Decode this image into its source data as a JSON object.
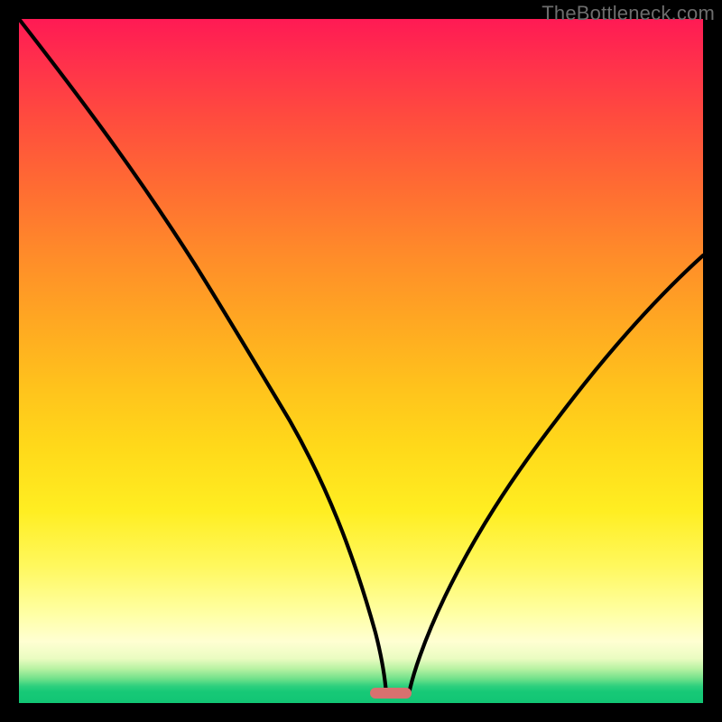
{
  "watermark": "TheBottleneck.com",
  "colors": {
    "frame": "#000000",
    "curve": "#000000",
    "pill": "#d8716f",
    "gradient_stops": [
      {
        "pos": 0,
        "color": "#ff1a54"
      },
      {
        "pos": 0.35,
        "color": "#ff8a2a"
      },
      {
        "pos": 0.65,
        "color": "#ffdf1a"
      },
      {
        "pos": 0.9,
        "color": "#ffffd2"
      },
      {
        "pos": 1.0,
        "color": "#12c574"
      }
    ]
  },
  "chart_data": {
    "type": "line",
    "title": "",
    "xlabel": "",
    "ylabel": "",
    "xlim": [
      0,
      100
    ],
    "ylim": [
      0,
      100
    ],
    "grid": false,
    "legend": null,
    "annotations": [
      {
        "type": "pill",
        "x_center": 54,
        "y": 0.5,
        "width": 6,
        "color": "#d8716f"
      }
    ],
    "series": [
      {
        "name": "left-branch",
        "x": [
          0,
          4,
          8,
          12,
          16,
          20,
          24,
          28,
          32,
          36,
          40,
          44,
          48,
          51,
          53
        ],
        "y": [
          100,
          92,
          84,
          76,
          69,
          62,
          57,
          50,
          42,
          34,
          26,
          18,
          10,
          4,
          1
        ]
      },
      {
        "name": "right-branch",
        "x": [
          55,
          58,
          62,
          66,
          70,
          74,
          78,
          82,
          86,
          90,
          94,
          98,
          100
        ],
        "y": [
          1,
          4,
          9,
          14,
          20,
          26,
          32,
          38,
          44,
          50,
          56,
          62,
          65
        ]
      }
    ],
    "note": "x and y are percentages of the plot-area width/height; y=0 is the bottom (green band), y=100 is the top (red). The two branches form a V meeting near x≈54, y≈0 where the pink pill sits."
  }
}
